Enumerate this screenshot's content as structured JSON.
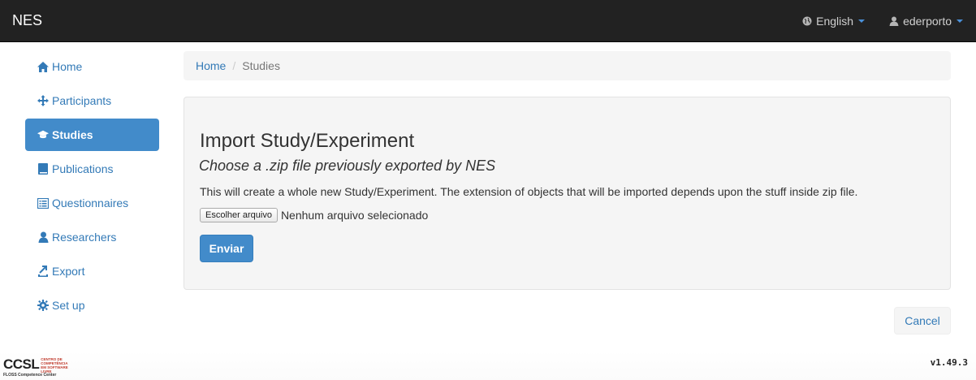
{
  "navbar": {
    "brand": "NES",
    "language_label": "English",
    "user_label": "ederporto",
    "language_icon": "globe-icon",
    "user_icon": "user-icon"
  },
  "sidebar": {
    "items": [
      {
        "label": "Home",
        "icon": "home-icon"
      },
      {
        "label": "Participants",
        "icon": "move-icon"
      },
      {
        "label": "Studies",
        "icon": "graduation-cap-icon",
        "active": true
      },
      {
        "label": "Publications",
        "icon": "book-icon"
      },
      {
        "label": "Questionnaires",
        "icon": "list-alt-icon"
      },
      {
        "label": "Researchers",
        "icon": "user-icon"
      },
      {
        "label": "Export",
        "icon": "export-icon"
      },
      {
        "label": "Set up",
        "icon": "cog-icon"
      }
    ],
    "active_color": "#428bca"
  },
  "breadcrumb": {
    "home": "Home",
    "separator": "/",
    "current": "Studies"
  },
  "import": {
    "title": "Import Study/Experiment",
    "subtitle": "Choose a .zip file previously exported by NES",
    "description": "This will create a whole new Study/Experiment. The extension of objects that will be imported depends upon the stuff inside zip file.",
    "file_button": "Escolher arquivo",
    "file_status": "Nenhum arquivo selecionado",
    "submit_label": "Enviar"
  },
  "cancel_label": "Cancel",
  "footer": {
    "logo_text": "CCSL",
    "logo_side_text": "Centro de Competência em Software Livre",
    "logo_subtext": "FLOSS Competence Center",
    "version": "v1.49.3"
  }
}
